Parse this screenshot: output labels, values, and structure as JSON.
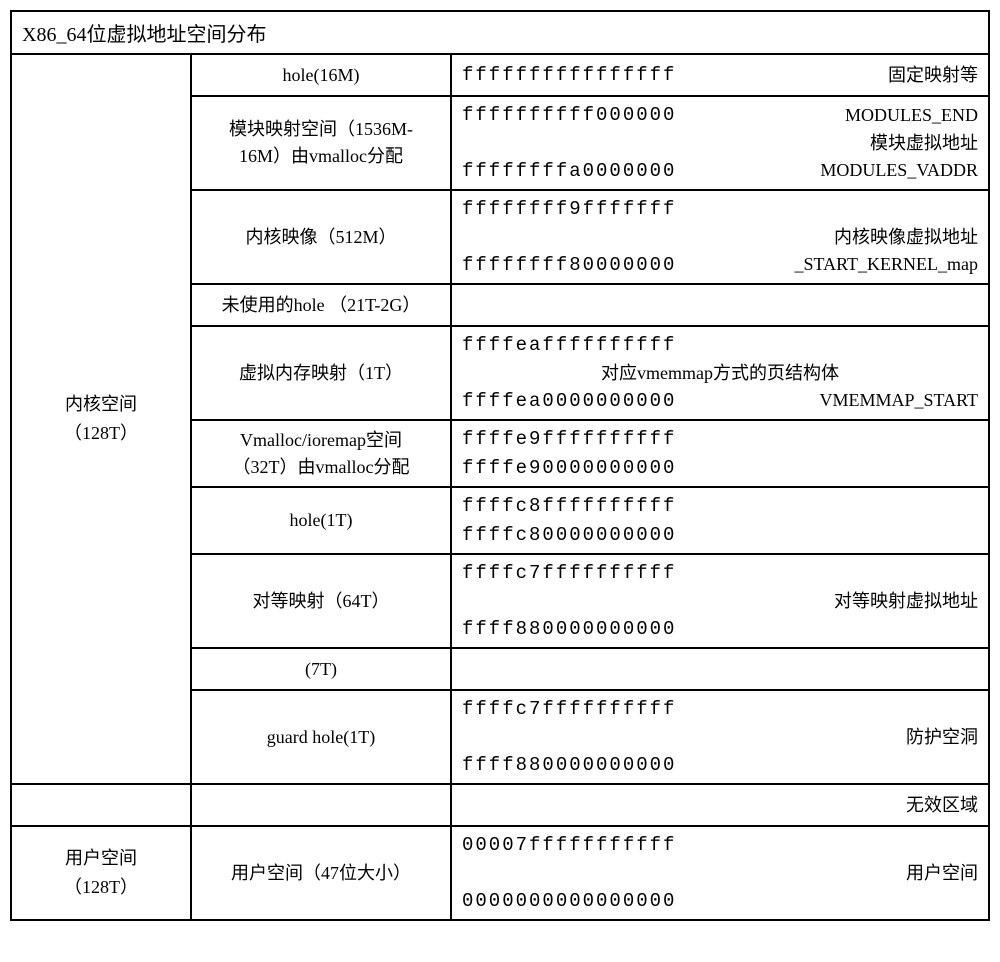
{
  "title": "X86_64位虚拟地址空间分布",
  "kernel": {
    "label1": "内核空间",
    "label2": "（128T）",
    "rows": [
      {
        "mid": [
          "hole(16M)"
        ],
        "lines": [
          {
            "addr": "ffffffffffffffff",
            "note": "固定映射等"
          }
        ]
      },
      {
        "mid": [
          "模块映射空间（1536M-",
          "16M）由vmalloc分配"
        ],
        "lines": [
          {
            "addr": "ffffffffff000000",
            "note": "MODULES_END"
          },
          {
            "addr": "",
            "note": "模块虚拟地址"
          },
          {
            "addr": "ffffffffa0000000",
            "note": "MODULES_VADDR"
          }
        ]
      },
      {
        "mid": [
          "内核映像（512M）"
        ],
        "lines": [
          {
            "addr": "ffffffff9fffffff",
            "note": ""
          },
          {
            "addr": "",
            "note": "内核映像虚拟地址"
          },
          {
            "addr": "ffffffff80000000",
            "note": "_START_KERNEL_map"
          }
        ]
      },
      {
        "mid": [
          "未使用的hole （21T-2G）"
        ],
        "lines": []
      },
      {
        "mid": [
          "虚拟内存映射（1T）"
        ],
        "lines": [
          {
            "addr": "ffffeaffffffffff",
            "note": ""
          },
          {
            "addr": "",
            "mid": "对应vmemmap方式的页结构体"
          },
          {
            "addr": "ffffea0000000000",
            "note": "VMEMMAP_START"
          }
        ]
      },
      {
        "mid": [
          "Vmalloc/ioremap空间",
          "（32T）由vmalloc分配"
        ],
        "lines": [
          {
            "addr": "ffffe9ffffffffff",
            "note": ""
          },
          {
            "addr": "",
            "note": ""
          },
          {
            "addr": "ffffe90000000000",
            "note": ""
          }
        ]
      },
      {
        "mid": [
          "hole(1T)"
        ],
        "lines": [
          {
            "addr": "ffffc8ffffffffff",
            "note": ""
          },
          {
            "addr": "",
            "note": ""
          },
          {
            "addr": "ffffc80000000000",
            "note": ""
          }
        ]
      },
      {
        "mid": [
          "对等映射（64T）"
        ],
        "lines": [
          {
            "addr": "ffffc7ffffffffff",
            "note": ""
          },
          {
            "addr": "",
            "note": "对等映射虚拟地址"
          },
          {
            "addr": "ffff880000000000",
            "note": ""
          }
        ]
      },
      {
        "mid": [
          "(7T)"
        ],
        "lines": []
      },
      {
        "mid": [
          "guard hole(1T)"
        ],
        "lines": [
          {
            "addr": "ffffc7ffffffffff",
            "note": ""
          },
          {
            "addr": "",
            "note": "防护空洞"
          },
          {
            "addr": "ffff880000000000",
            "note": ""
          }
        ]
      }
    ]
  },
  "invalid": {
    "note": "无效区域"
  },
  "user": {
    "label1": "用户空间",
    "label2": "（128T）",
    "mid": "用户空间（47位大小）",
    "lines": [
      {
        "addr": "00007fffffffffff",
        "note": ""
      },
      {
        "addr": "",
        "note": "用户空间"
      },
      {
        "addr": "0000000000000000",
        "note": ""
      }
    ]
  }
}
